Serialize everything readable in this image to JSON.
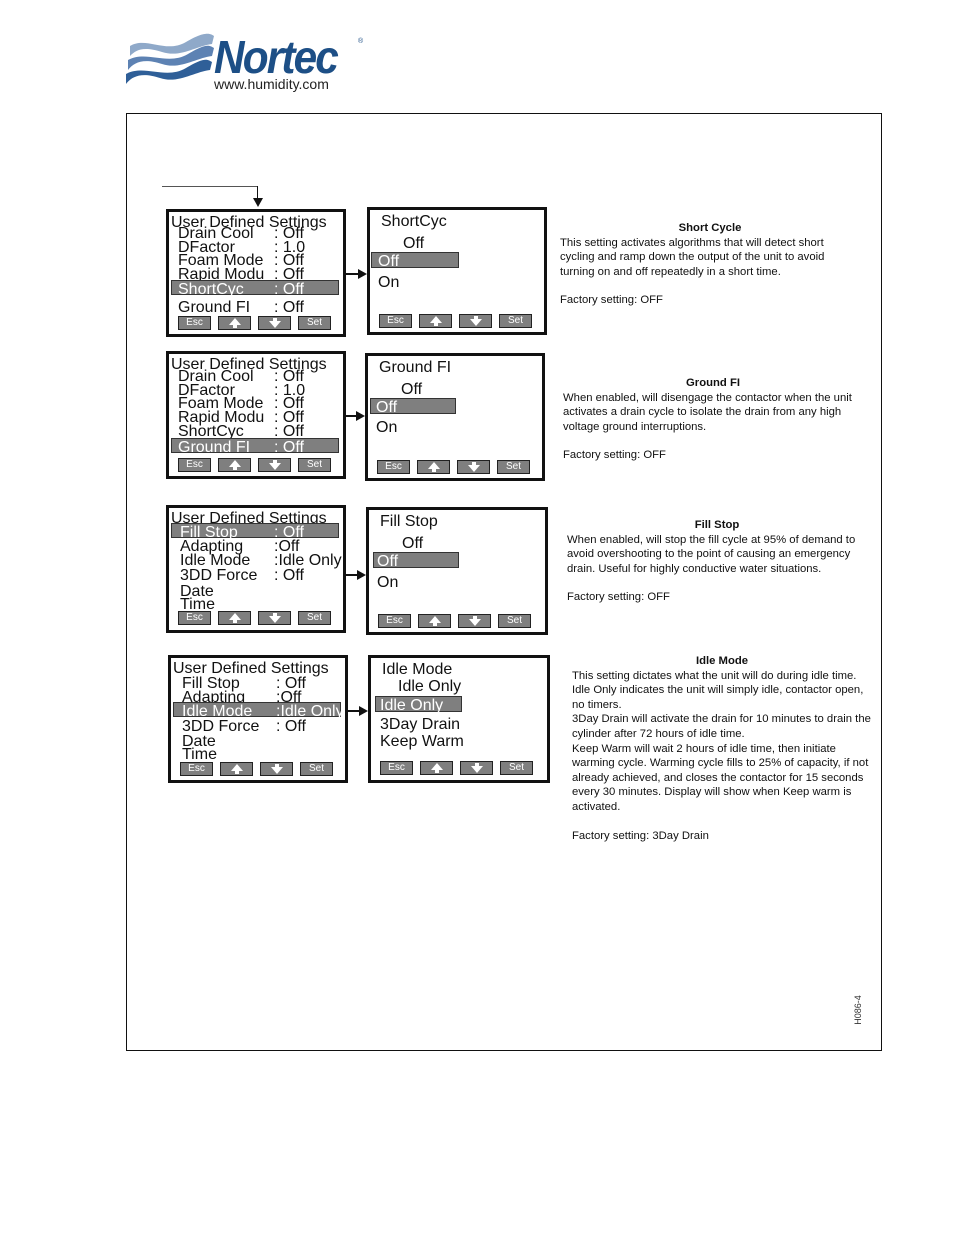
{
  "logo": {
    "brand": "Nortec",
    "registered": "®",
    "url": "www.humidity.com",
    "brand_color": "#1d4f86"
  },
  "figure_id": "H086-4",
  "buttons": {
    "esc": "Esc",
    "set": "Set",
    "up_icon": "up-arrow",
    "down_icon": "down-arrow"
  },
  "colors": {
    "highlight": "#7f7f7f",
    "button": "#7f7f7f"
  },
  "panels": [
    {
      "menu": {
        "title": "User Defined Settings",
        "rows": [
          {
            "label": "Drain Cool",
            "value": ": Off"
          },
          {
            "label": "DFactor",
            "value": ": 1.0"
          },
          {
            "label": "Foam Mode",
            "value": ": Off"
          },
          {
            "label": "Rapid Modu",
            "value": ": Off"
          },
          {
            "label": "ShortCyc",
            "value": ": Off",
            "selected": true
          },
          {
            "label": "Ground FI",
            "value": ": Off"
          }
        ]
      },
      "submenu": {
        "title": "ShortCyc",
        "current": "Off",
        "options": [
          "Off",
          "On"
        ],
        "selected_option": "Off"
      },
      "description": {
        "title": "Short Cycle",
        "paragraphs": [
          "This setting activates algorithms that will detect short cycling and ramp down the output of the unit to avoid turning on and off repeatedly in a short time."
        ],
        "factory": "Factory setting: OFF"
      }
    },
    {
      "menu": {
        "title": "User Defined Settings",
        "rows": [
          {
            "label": "Drain Cool",
            "value": ": Off"
          },
          {
            "label": "DFactor",
            "value": ": 1.0"
          },
          {
            "label": "Foam Mode",
            "value": ": Off"
          },
          {
            "label": "Rapid Modu",
            "value": ": Off"
          },
          {
            "label": "ShortCyc",
            "value": ": Off"
          },
          {
            "label": "Ground FI",
            "value": ": Off",
            "selected": true
          }
        ]
      },
      "submenu": {
        "title": "Ground FI",
        "current": "Off",
        "options": [
          "Off",
          "On"
        ],
        "selected_option": "Off"
      },
      "description": {
        "title": "Ground FI",
        "paragraphs": [
          "When enabled, will disengage the contactor when the unit activates a drain cycle to isolate the drain from any high voltage ground interruptions."
        ],
        "factory": "Factory setting: OFF"
      }
    },
    {
      "menu": {
        "title": "User Defined Settings",
        "rows": [
          {
            "label": "Fill Stop",
            "value": ": Off",
            "selected": true
          },
          {
            "label": "Adapting",
            "value": ":Off"
          },
          {
            "label": "Idle Mode",
            "value": ":Idle Only"
          },
          {
            "label": "3DD Force",
            "value": ": Off"
          },
          {
            "label": "Date",
            "value": ""
          },
          {
            "label": "Time",
            "value": ""
          }
        ]
      },
      "submenu": {
        "title": "Fill Stop",
        "current": "Off",
        "options": [
          "Off",
          "On"
        ],
        "selected_option": "Off"
      },
      "description": {
        "title": "Fill Stop",
        "paragraphs": [
          "When enabled, will stop the fill cycle at 95% of demand to avoid overshooting to the point of causing an emergency drain.  Useful for highly conductive water situations."
        ],
        "factory": "Factory setting: OFF"
      }
    },
    {
      "menu": {
        "title": "User Defined Settings",
        "rows": [
          {
            "label": "Fill Stop",
            "value": ": Off"
          },
          {
            "label": "Adapting",
            "value": ":Off"
          },
          {
            "label": "Idle Mode",
            "value": ":Idle Only",
            "selected": true
          },
          {
            "label": "3DD Force",
            "value": ": Off"
          },
          {
            "label": "Date",
            "value": ""
          },
          {
            "label": "Time",
            "value": ""
          }
        ]
      },
      "submenu": {
        "title": "Idle Mode",
        "current": "Idle Only",
        "options": [
          "Idle Only",
          "3Day Drain",
          "Keep Warm"
        ],
        "selected_option": "Idle Only"
      },
      "description": {
        "title": "Idle Mode",
        "paragraphs": [
          "This setting dictates what the unit will do during idle time.",
          "Idle Only indicates the unit will simply idle, contactor open, no timers.",
          "3Day Drain will activate the drain for 10 minutes to drain the cylinder after 72 hours of idle time.",
          "Keep Warm will wait 2 hours of idle time, then initiate warming cycle.  Warming cycle fills to 25% of capacity, if not already achieved,  and closes the contactor for 15 seconds every 30 minutes.  Display will show when Keep warm is activated."
        ],
        "factory": "Factory setting: 3Day Drain"
      }
    }
  ]
}
